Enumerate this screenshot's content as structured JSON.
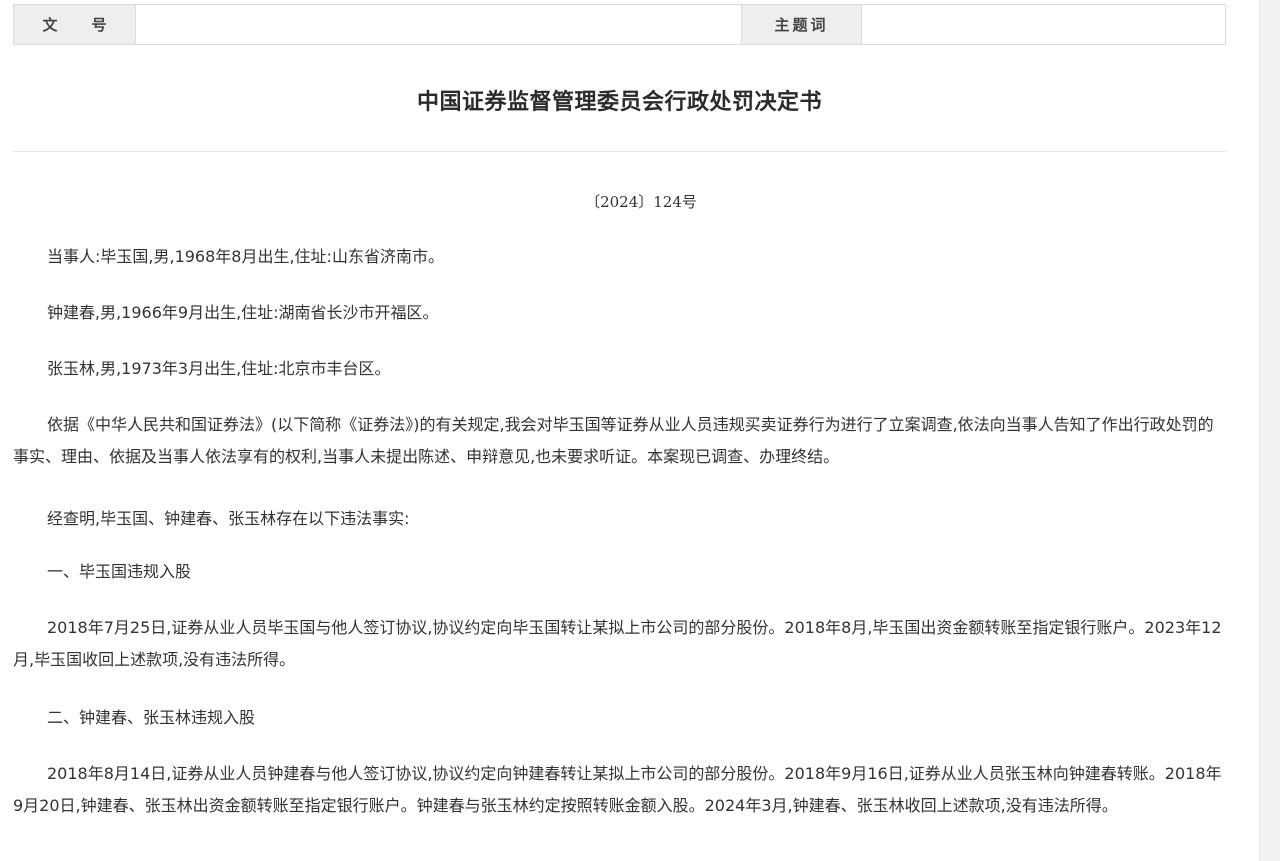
{
  "meta": {
    "wenhao_label_a": "文",
    "wenhao_label_b": "号",
    "wenhao_value": "",
    "zhuti_label": "主题词",
    "zhuti_value": ""
  },
  "document": {
    "title": "中国证券监督管理委员会行政处罚决定书",
    "number": "〔2024〕124号",
    "paragraphs": [
      "当事人:毕玉国,男,1968年8月出生,住址:山东省济南市。",
      "钟建春,男,1966年9月出生,住址:湖南省长沙市开福区。",
      "张玉林,男,1973年3月出生,住址:北京市丰台区。",
      "依据《中华人民共和国证券法》(以下简称《证券法》)的有关规定,我会对毕玉国等证券从业人员违规买卖证券行为进行了立案调查,依法向当事人告知了作出行政处罚的事实、理由、依据及当事人依法享有的权利,当事人未提出陈述、申辩意见,也未要求听证。本案现已调查、办理终结。",
      "经查明,毕玉国、钟建春、张玉林存在以下违法事实:",
      "一、毕玉国违规入股",
      "2018年7月25日,证券从业人员毕玉国与他人签订协议,协议约定向毕玉国转让某拟上市公司的部分股份。2018年8月,毕玉国出资金额转账至指定银行账户。2023年12月,毕玉国收回上述款项,没有违法所得。",
      "二、钟建春、张玉林违规入股",
      "2018年8月14日,证券从业人员钟建春与他人签订协议,协议约定向钟建春转让某拟上市公司的部分股份。2018年9月16日,证券从业人员张玉林向钟建春转账。2018年9月20日,钟建春、张玉林出资金额转账至指定银行账户。钟建春与张玉林约定按照转账金额入股。2024年3月,钟建春、张玉林收回上述款项,没有违法所得。"
    ]
  }
}
